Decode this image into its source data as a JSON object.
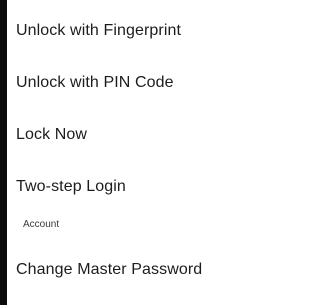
{
  "settings": {
    "items": [
      {
        "label": "Unlock with Fingerprint"
      },
      {
        "label": "Unlock with PIN Code"
      },
      {
        "label": "Lock Now"
      },
      {
        "label": "Two-step Login"
      }
    ],
    "sections": {
      "account": {
        "header": "Account",
        "items": [
          {
            "label": "Change Master Password"
          }
        ]
      }
    }
  },
  "colors": {
    "background": "#ffffff",
    "text": "#1c1c1c",
    "section_header": "#3a3a3a",
    "edge_strip": "#0b0b0b"
  }
}
